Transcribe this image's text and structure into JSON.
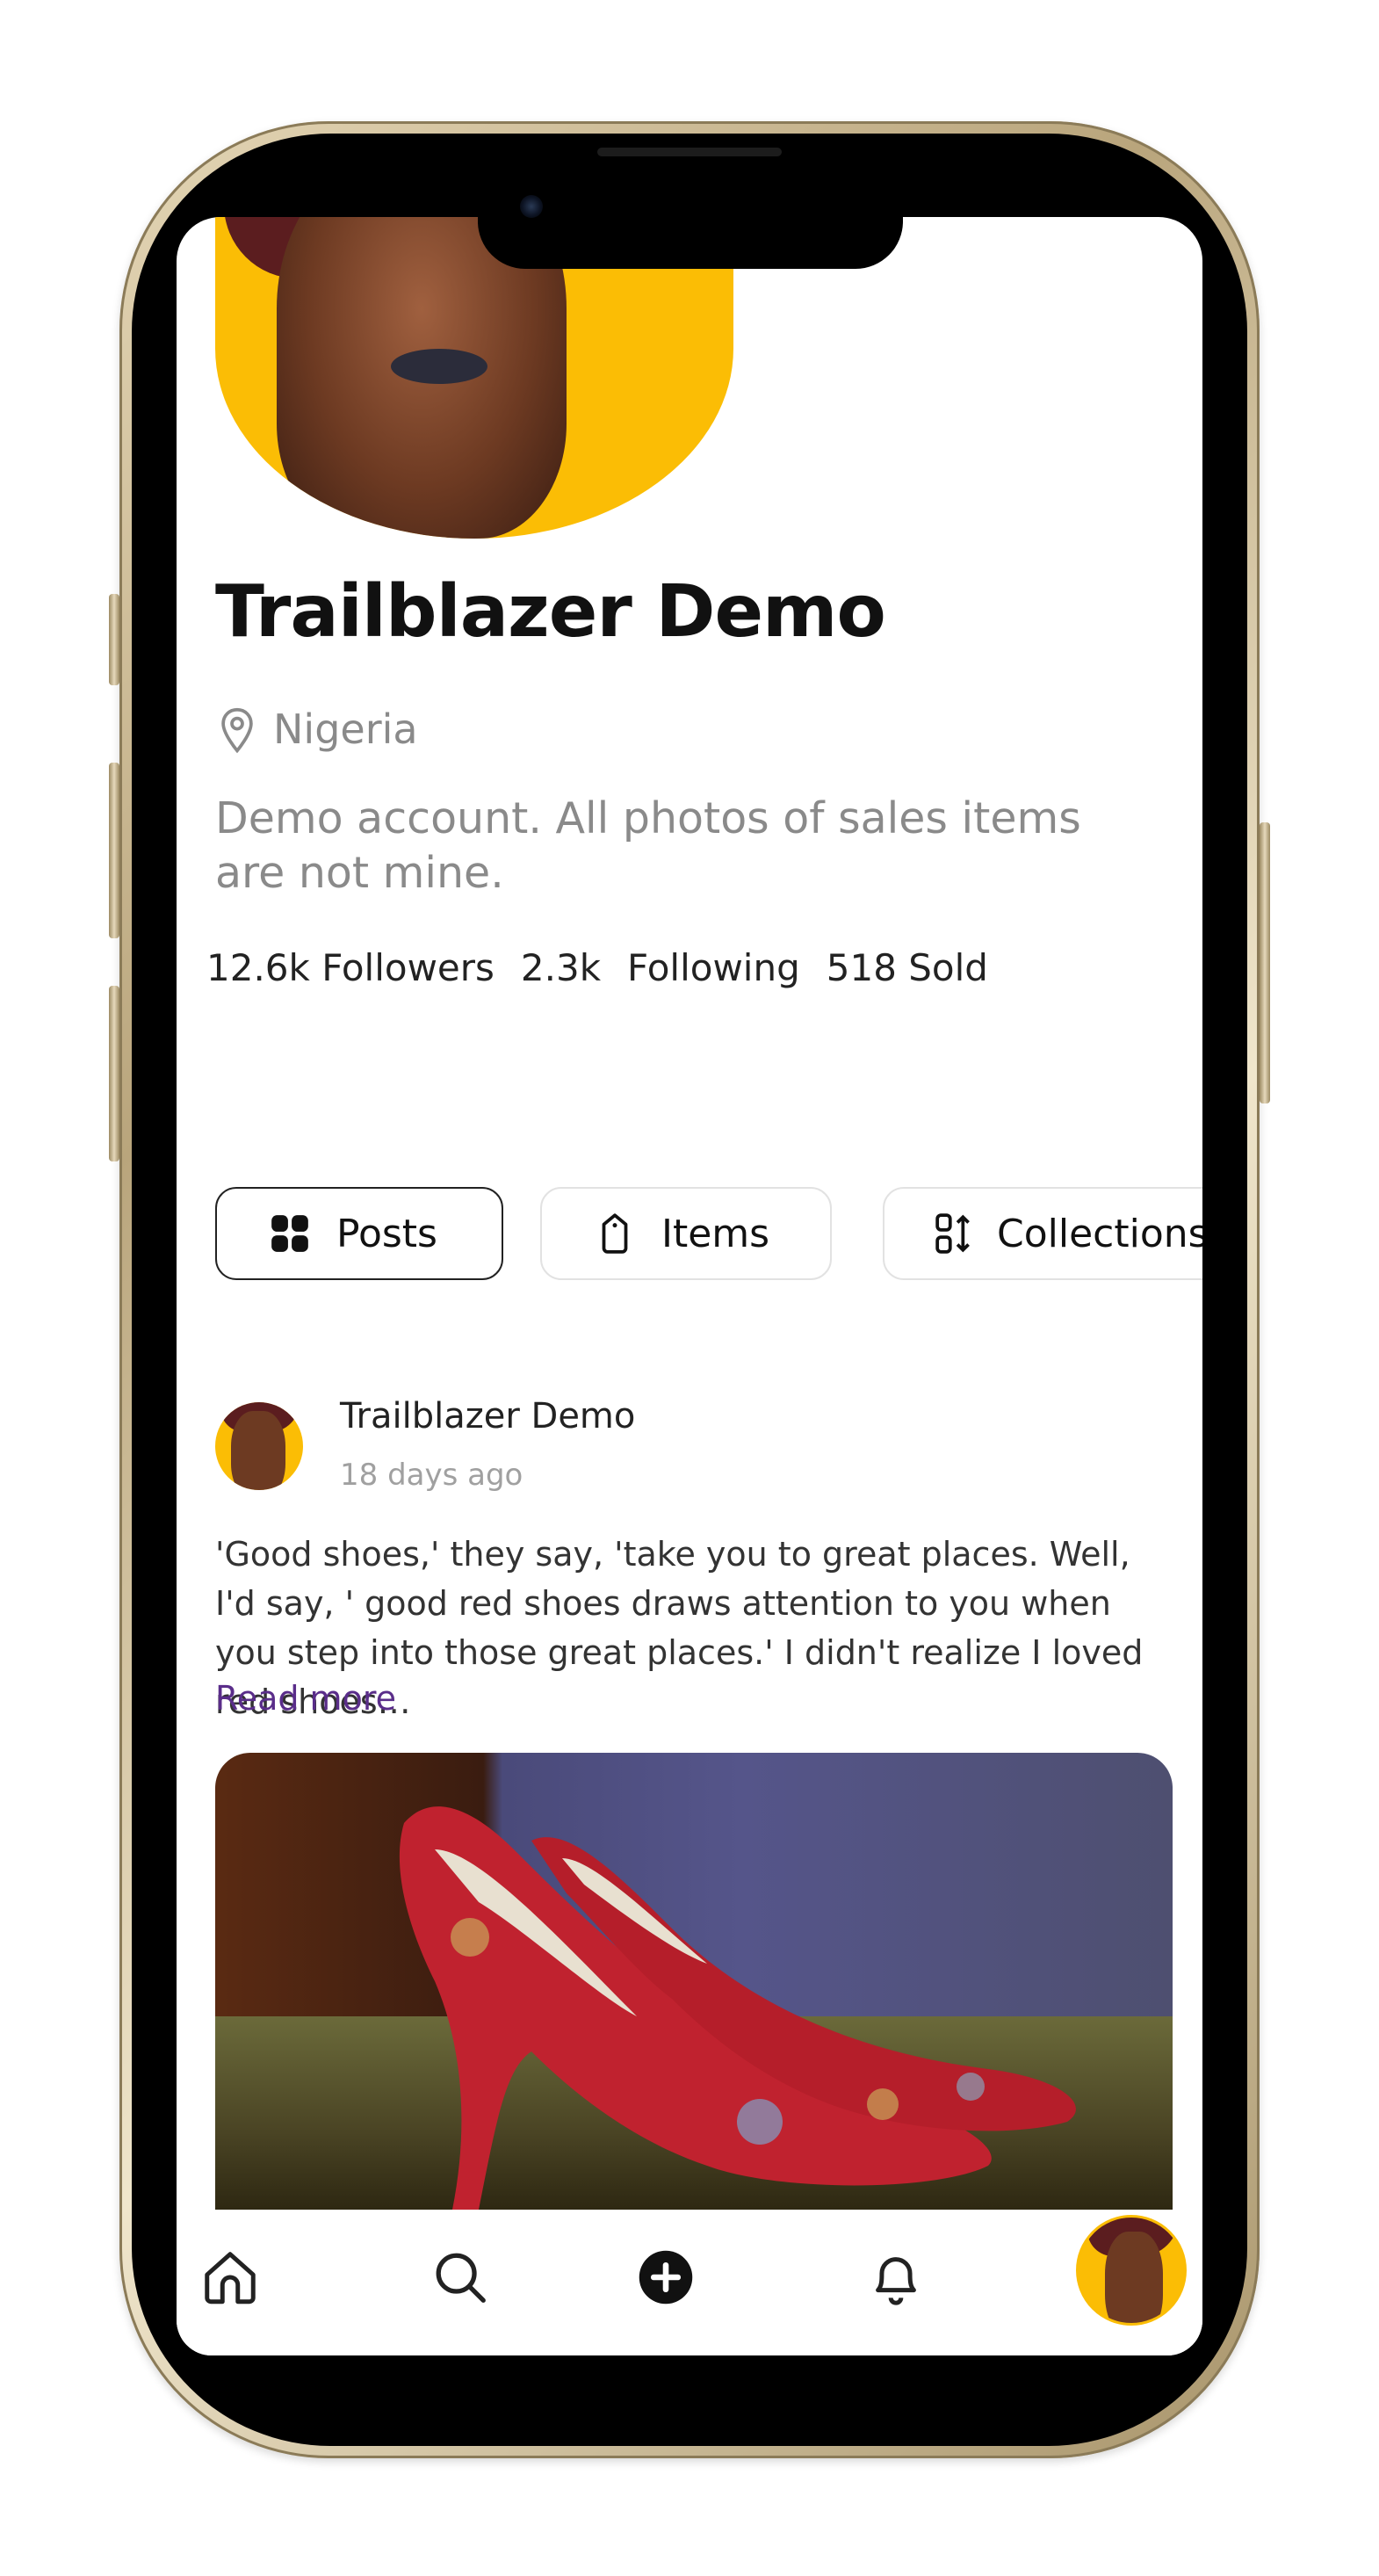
{
  "profile": {
    "name": "Trailblazer Demo",
    "location": "Nigeria",
    "bio": "Demo account. All photos of sales items are not mine.",
    "stats": {
      "followers": "12.6k Followers",
      "following_count": "2.3k",
      "following_label": "Following",
      "sold": "518 Sold"
    }
  },
  "tabs": [
    {
      "label": "Posts",
      "icon": "grid-icon",
      "active": true
    },
    {
      "label": "Items",
      "icon": "tag-icon",
      "active": false
    },
    {
      "label": "Collections",
      "icon": "sort-icon",
      "active": false
    }
  ],
  "post": {
    "author": "Trailblazer Demo",
    "time": "18 days ago",
    "text": "'Good shoes,' they say, 'take you to great places. Well, I'd say, ' good red shoes draws attention to you when you step into those great places.' I didn't realize I loved red shoes…",
    "read_more": "Read more"
  },
  "bottom_nav": [
    {
      "name": "home-icon"
    },
    {
      "name": "search-icon"
    },
    {
      "name": "add-icon"
    },
    {
      "name": "bell-icon"
    },
    {
      "name": "profile-avatar"
    }
  ],
  "colors": {
    "accent_yellow": "#fbbd05",
    "link_purple": "#5a2d8a",
    "muted_text": "#8a8a8a"
  }
}
